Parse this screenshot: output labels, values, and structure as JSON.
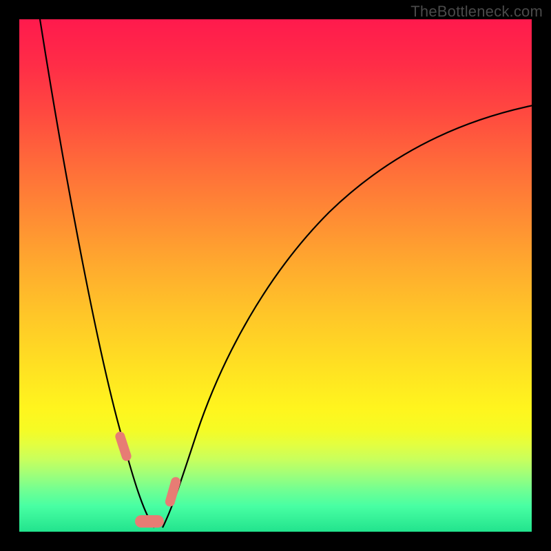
{
  "watermark": "TheBottleneck.com",
  "colors": {
    "frame_bg_stops": [
      "#ff1a4d",
      "#ff2d47",
      "#ff4840",
      "#ff6a3a",
      "#ff8a34",
      "#ffaa2e",
      "#ffc728",
      "#ffe122",
      "#fff51e",
      "#f6fb24",
      "#e3fe40",
      "#c7ff5e",
      "#9dff7b",
      "#6fff93",
      "#48ffa3",
      "#22e38d"
    ],
    "curve_stroke": "#000000",
    "marker_fill": "#e77c74"
  },
  "chart_data": {
    "type": "line",
    "title": "",
    "xlabel": "",
    "ylabel": "",
    "xlim": [
      0,
      100
    ],
    "ylim": [
      0,
      100
    ],
    "grid": false,
    "legend": false,
    "series": [
      {
        "name": "left-branch",
        "x": [
          4,
          6,
          8,
          10,
          12,
          14,
          16,
          18,
          20,
          22.5,
          25
        ],
        "values": [
          100,
          90,
          80,
          70,
          60,
          50,
          40,
          30,
          20,
          10,
          0
        ]
      },
      {
        "name": "right-branch",
        "x": [
          28,
          30,
          33,
          36,
          40,
          45,
          50,
          56,
          63,
          71,
          80,
          89,
          99
        ],
        "values": [
          0,
          6,
          14,
          22,
          31,
          40,
          48,
          55,
          62,
          68,
          74,
          79,
          83
        ]
      }
    ],
    "annotations": {
      "markers": [
        {
          "x_range": [
            19.5,
            20.7
          ],
          "y_range": [
            14,
            20
          ],
          "shape": "capsule-diag"
        },
        {
          "x_range": [
            22.5,
            27.5
          ],
          "y_range": [
            0,
            3
          ],
          "shape": "capsule-horiz"
        },
        {
          "x_range": [
            29.3,
            30.7
          ],
          "y_range": [
            5,
            11
          ],
          "shape": "capsule-diag"
        }
      ]
    }
  }
}
